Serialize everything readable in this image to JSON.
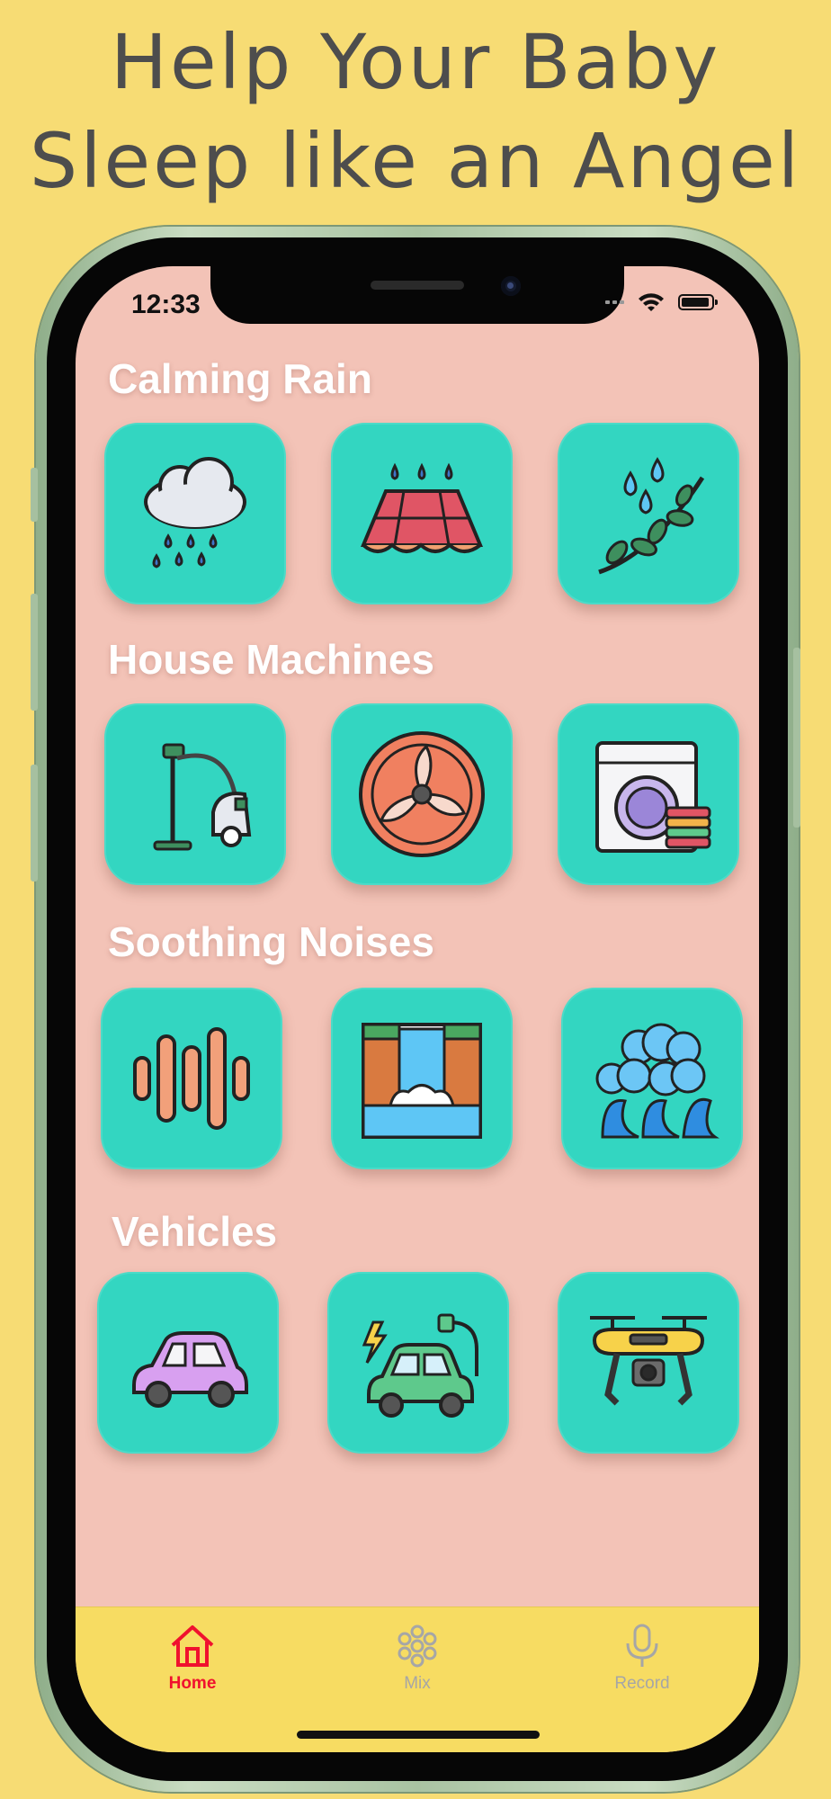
{
  "headline": [
    "Help Your Baby",
    "Sleep like an Angel"
  ],
  "status_bar": {
    "time": "12:33"
  },
  "sections": [
    {
      "title": "Calming Rain",
      "items": [
        {
          "icon": "rain-cloud-icon"
        },
        {
          "icon": "rain-on-roof-icon"
        },
        {
          "icon": "rain-on-leaves-icon"
        }
      ]
    },
    {
      "title": "House Machines",
      "items": [
        {
          "icon": "vacuum-cleaner-icon"
        },
        {
          "icon": "fan-icon"
        },
        {
          "icon": "washing-machine-icon"
        }
      ]
    },
    {
      "title": "Soothing Noises",
      "items": [
        {
          "icon": "sound-wave-icon"
        },
        {
          "icon": "waterfall-icon"
        },
        {
          "icon": "ocean-waves-icon"
        }
      ]
    },
    {
      "title": "Vehicles",
      "items": [
        {
          "icon": "car-icon"
        },
        {
          "icon": "electric-car-icon"
        },
        {
          "icon": "drone-icon"
        }
      ]
    }
  ],
  "tabs": [
    {
      "label": "Home",
      "icon": "home-icon",
      "active": true
    },
    {
      "label": "Mix",
      "icon": "mix-icon",
      "active": false
    },
    {
      "label": "Record",
      "icon": "microphone-icon",
      "active": false
    }
  ],
  "colors": {
    "background": "#f7dc74",
    "screen": "#f3c3b7",
    "tile": "#33d6c1",
    "tabbar": "#f7dc62",
    "active_tab": "#f0112e",
    "inactive_tab": "#a6a6a6"
  }
}
